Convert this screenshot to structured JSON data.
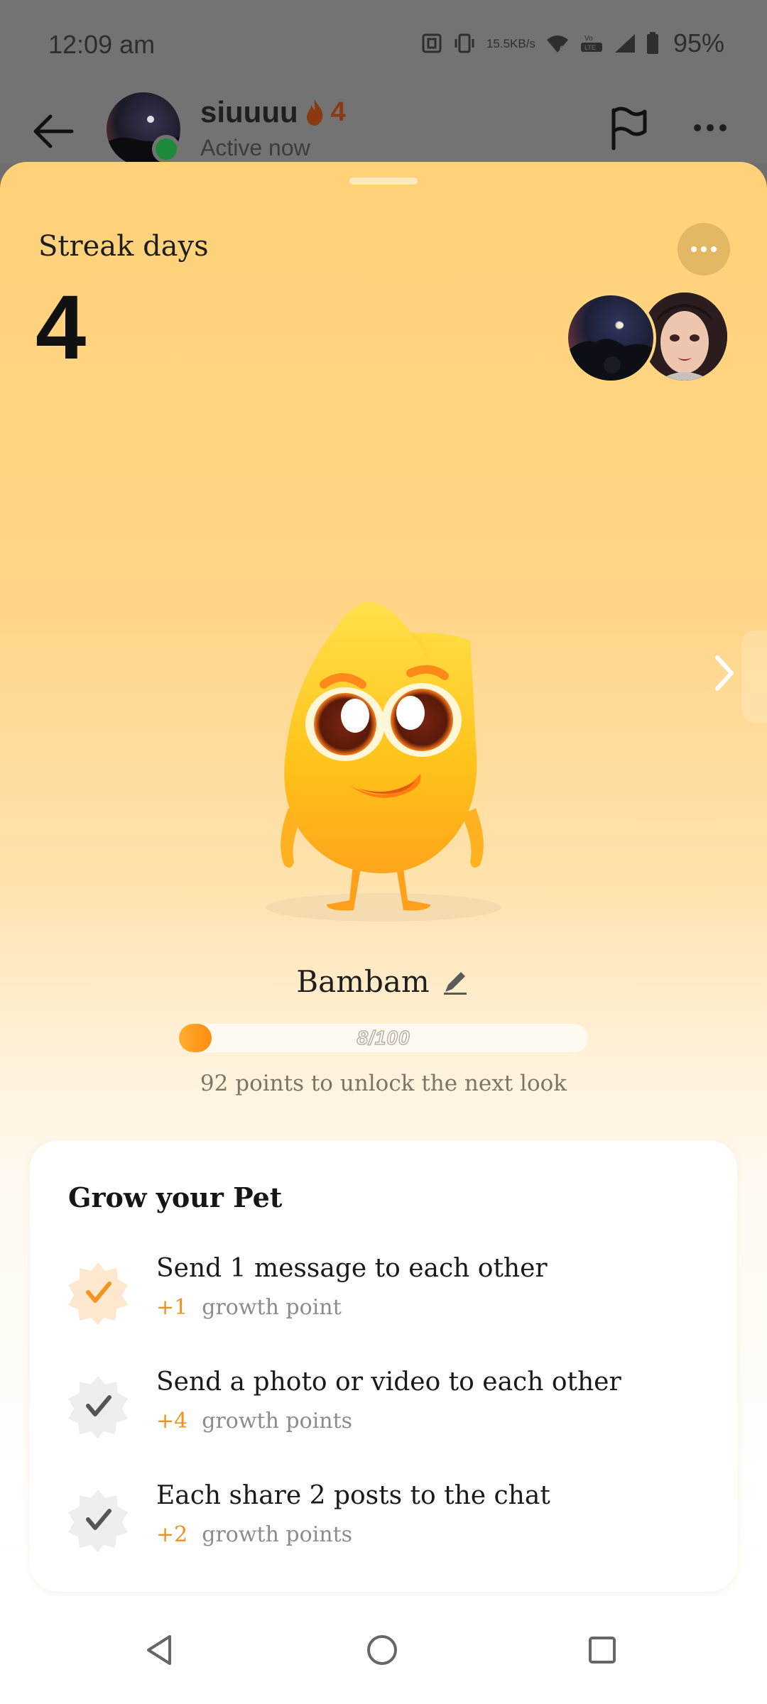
{
  "status_bar": {
    "time": "12:09 am",
    "net_speed_value": "15.5",
    "net_speed_unit": "KB/s",
    "battery": "95%"
  },
  "chat_header": {
    "name": "siuuuu",
    "streak_count": "4",
    "status": "Active now",
    "accent_color": "#8a3a12",
    "online_color": "#1d8a3a"
  },
  "sheet": {
    "streak_label": "Streak days",
    "streak_number": "4",
    "pet_name": "Bambam",
    "progress": {
      "current": 8,
      "max": 100,
      "label": "8/100"
    },
    "unlock_text": "92 points to unlock the next look",
    "colors": {
      "gradient_top": "#ffd279",
      "progress_fill": "#ff8c12",
      "points_accent": "#f0911c"
    }
  },
  "tasks": {
    "title": "Grow your Pet",
    "items": [
      {
        "title": "Send 1 message to each other",
        "plus": "+1",
        "unit": "growth point",
        "completed": true
      },
      {
        "title": "Send a photo or video to each other",
        "plus": "+4",
        "unit": "growth points",
        "completed": false
      },
      {
        "title": "Each share 2 posts to the chat",
        "plus": "+2",
        "unit": "growth points",
        "completed": false
      }
    ]
  },
  "icons": {
    "back": "arrow-left",
    "flag": "flag",
    "more": "ellipsis",
    "edit": "pencil",
    "next": "chevron-right",
    "nav": [
      "triangle-back",
      "circle-home",
      "square-recents"
    ]
  }
}
